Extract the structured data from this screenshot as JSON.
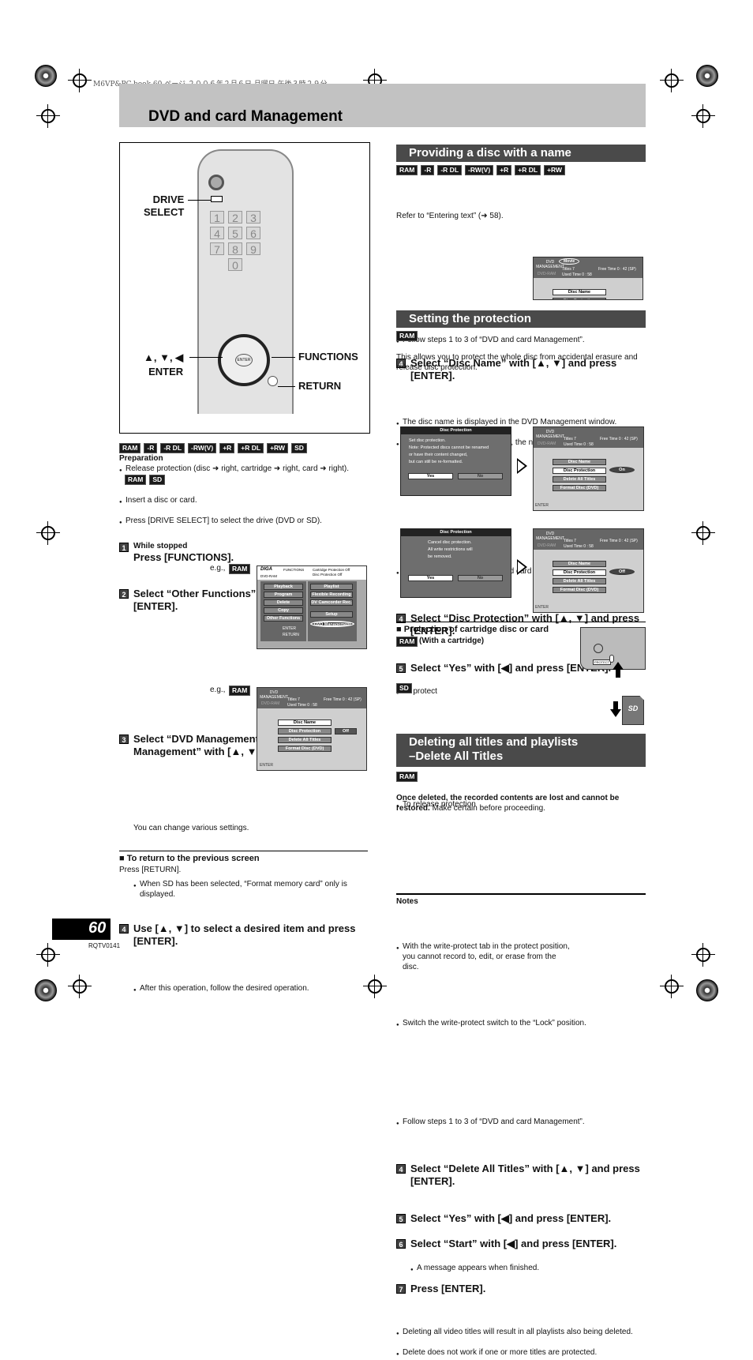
{
  "header": {
    "print_info": "M6VP&PC.book  60 ページ  ２００６年２月６日  月曜日  午後３時２９分",
    "title": "DVD and card Management"
  },
  "remote": {
    "drive_select": [
      "DRIVE",
      "SELECT"
    ],
    "arrows_enter": [
      "▲, ▼, ◀",
      "ENTER"
    ],
    "functions": "FUNCTIONS",
    "return": "RETURN",
    "keys": [
      "1",
      "2",
      "3",
      "4",
      "5",
      "6",
      "7",
      "8",
      "9",
      "0"
    ],
    "enter_key": "ENTER"
  },
  "left": {
    "tags": [
      "RAM",
      "-R",
      "-R DL",
      "-RW(V)",
      "+R",
      "+R DL",
      "+RW",
      "SD"
    ],
    "preparation": "Preparation",
    "prep_bullet1": "Release protection (disc ➜ right, cartridge ➜ right, card ➜ right).",
    "prep_tags": [
      "RAM",
      "SD"
    ],
    "prep_bullet2": "Insert a disc or card.",
    "prep_bullet3": "Press [DRIVE SELECT] to select the drive (DVD or SD).",
    "step1_num": "1",
    "step1_sub": "While stopped",
    "step1": "Press [FUNCTIONS].",
    "step2_num": "2",
    "step2": "Select “Other Functions” with [▲, ▼] and press [ENTER].",
    "eg": "e.g.,",
    "eg_tag": "RAM",
    "functions_screen": {
      "brand": "DIGA",
      "title": "FUNCTIONS",
      "drive": "DVD-RAM",
      "status1": "Cartridge Protection Off",
      "status2": "Disc Protection Off",
      "left_items": [
        "Playback",
        "Program",
        "Delete",
        "Copy",
        "Other Functions"
      ],
      "right_items": [
        "Playlist",
        "Flexible Recording",
        "DV Camcorder Rec.",
        "Setup",
        "DVD Management"
      ],
      "enter": "ENTER",
      "return": "RETURN"
    },
    "step3_num": "3",
    "step3": "Select “DVD Management” or “Card Management” with [▲, ▼] and press [ENTER].",
    "mgmt_screen": {
      "title": "DVD MANAGEMENT",
      "drive": "DVD-RAM",
      "titles": "Titles       7",
      "used": "Used Time 0 : 58",
      "free": "Free Time  0 : 42 (SP)",
      "items": [
        "Disc Name",
        "Disc Protection",
        "Delete All Titles",
        "Format Disc (DVD)"
      ],
      "value": "Off",
      "enter": "ENTER"
    },
    "sd_note": "When SD has been selected, “Format memory card” only is displayed.",
    "step4_num": "4",
    "step4": "Use [▲, ▼] to select a desired item and press [ENTER].",
    "step4_text": "You can change various settings.",
    "step4_bullet": "After this operation, follow the desired operation.",
    "return_heading": "■ To return to the previous screen",
    "return_text": "Press [RETURN]."
  },
  "name": {
    "heading": "Providing a disc with a name",
    "tags": [
      "RAM",
      "-R",
      "-R DL",
      "-RW(V)",
      "+R",
      "+R DL",
      "+RW"
    ],
    "follow": "Follow steps 1 to 3 of “DVD and card Management”.",
    "step4_num": "4",
    "step4": "Select “Disc Name” with [▲, ▼] and press [ENTER].",
    "refer": "Refer to “Entering text” (➜ 58).",
    "bullet1": "The disc name is displayed in the DVD Management window.",
    "bullet2": "With a finalized discs and +RW, the name is displayed on the Top Menu.",
    "screen_name": "Movie"
  },
  "protect": {
    "heading": "Setting the protection",
    "tag": "RAM",
    "follow": "Follow steps 1 to 3 of “DVD and card Management”.",
    "intro": "This allows you to protect the whole disc from accidental erasure and release disc protection.",
    "step4_num": "4",
    "step4": "Select “Disc Protection” with [▲, ▼] and press [ENTER].",
    "step5_num": "5",
    "step5": "Select “Yes” with [◀] and press [ENTER].",
    "to_protect": "To protect",
    "dialog_title": "Disc Protection",
    "protect_msg": [
      "Set disc protection.",
      "Note: Protected discs cannot be renamed",
      "or have their content changed,",
      "but can still be re-formatted."
    ],
    "yes": "Yes",
    "no": "No",
    "on": "On",
    "off": "Off",
    "to_release": "To release protection",
    "release_msg": [
      "Cancel disc protection.",
      "All write restrictions will",
      "be removed."
    ],
    "cart_heading": "■ Protection of cartridge disc or card",
    "cart_tag": "RAM",
    "cart_sub": "(With a cartridge)",
    "cart_bullet": "With the write-protect tab in the protect position, you cannot record to, edit, or erase from the disc.",
    "sd_tag": "SD",
    "sd_bullet": "Switch the write-protect switch to the “Lock” position.",
    "cart_label": "PROTECT"
  },
  "delete": {
    "heading": [
      "Deleting all titles and playlists",
      "–Delete All Titles"
    ],
    "tag": "RAM",
    "follow": "Follow steps 1 to 3 of “DVD and card Management”.",
    "warning_bold": "Once deleted, the recorded contents are lost and cannot be restored.",
    "warning_rest": " Make certain before proceeding.",
    "step4_num": "4",
    "step4": "Select “Delete All Titles” with [▲, ▼] and press [ENTER].",
    "step5_num": "5",
    "step5": "Select “Yes” with [◀] and press [ENTER].",
    "step6_num": "6",
    "step6": "Select “Start” with [◀] and press [ENTER].",
    "step6_bullet": "A message appears when finished.",
    "step7_num": "7",
    "step7": "Press [ENTER].",
    "notes": "Notes",
    "note1": "Deleting all video titles will result in all playlists also being deleted.",
    "note2": "Delete does not work if one or more titles are protected."
  },
  "footer": {
    "page": "60",
    "code": "RQTV0141"
  }
}
